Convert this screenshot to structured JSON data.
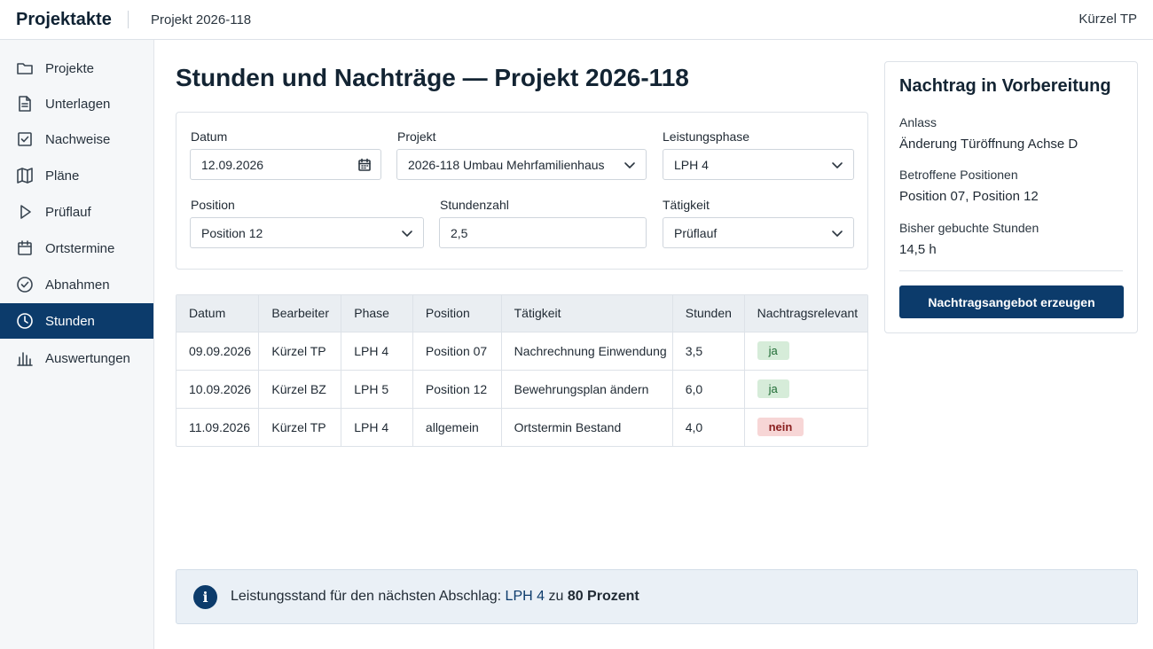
{
  "header": {
    "app_title": "Projektakte",
    "project": "Projekt 2026-118",
    "user": "Kürzel TP"
  },
  "sidebar": {
    "items": [
      {
        "label": "Projekte",
        "icon": "folder-icon",
        "active": false
      },
      {
        "label": "Unterlagen",
        "icon": "document-icon",
        "active": false
      },
      {
        "label": "Nachweise",
        "icon": "checkbox-icon",
        "active": false
      },
      {
        "label": "Pläne",
        "icon": "map-icon",
        "active": false
      },
      {
        "label": "Prüflauf",
        "icon": "play-icon",
        "active": false
      },
      {
        "label": "Ortstermine",
        "icon": "calendar-icon",
        "active": false
      },
      {
        "label": "Abnahmen",
        "icon": "check-circle-icon",
        "active": false
      },
      {
        "label": "Stunden",
        "icon": "clock-icon",
        "active": true
      },
      {
        "label": "Auswertungen",
        "icon": "bar-chart-icon",
        "active": false
      }
    ]
  },
  "page": {
    "title": "Stunden und Nachträge — Projekt 2026-118"
  },
  "form": {
    "datum_label": "Datum",
    "datum_value": "12.09.2026",
    "projekt_label": "Projekt",
    "projekt_value": "2026-118 Umbau Mehrfamilienhaus",
    "phase_label": "Leistungsphase",
    "phase_value": "LPH 4",
    "position_label": "Position",
    "position_value": "Position 12",
    "stunden_label": "Stundenzahl",
    "stunden_value": "2,5",
    "taetigkeit_label": "Tätigkeit",
    "taetigkeit_value": "Prüflauf"
  },
  "table": {
    "columns": [
      "Datum",
      "Bearbeiter",
      "Phase",
      "Position",
      "Tätigkeit",
      "Stunden",
      "Nachtragsrelevant"
    ],
    "rows": [
      {
        "datum": "09.09.2026",
        "bearbeiter": "Kürzel TP",
        "phase": "LPH 4",
        "position": "Position 07",
        "taetigkeit": "Nachrechnung Einwendung",
        "stunden": "3,5",
        "relevant": "ja"
      },
      {
        "datum": "10.09.2026",
        "bearbeiter": "Kürzel BZ",
        "phase": "LPH 5",
        "position": "Position 12",
        "taetigkeit": "Bewehrungsplan ändern",
        "stunden": "6,0",
        "relevant": "ja"
      },
      {
        "datum": "11.09.2026",
        "bearbeiter": "Kürzel TP",
        "phase": "LPH 4",
        "position": "allgemein",
        "taetigkeit": "Ortstermin Bestand",
        "stunden": "4,0",
        "relevant": "nein"
      }
    ]
  },
  "panel": {
    "title": "Nachtrag in Vorbereitung",
    "anlass_label": "Anlass",
    "anlass_value": "Änderung Türöffnung Achse D",
    "positionen_label": "Betroffene Positionen",
    "positionen_value": "Position 07, Position 12",
    "gebucht_label": "Bisher gebuchte Stunden",
    "gebucht_value": "14,5 h",
    "button": "Nachtragsangebot erzeugen"
  },
  "info": {
    "prefix": "Leistungsstand für den nächsten Abschlag: ",
    "phase": "LPH 4",
    "mid": " zu ",
    "percent": "80 Prozent"
  },
  "colors": {
    "primary": "#0c3b6b",
    "yes_bg": "#d6ecd9",
    "no_bg": "#f7d6d6"
  }
}
